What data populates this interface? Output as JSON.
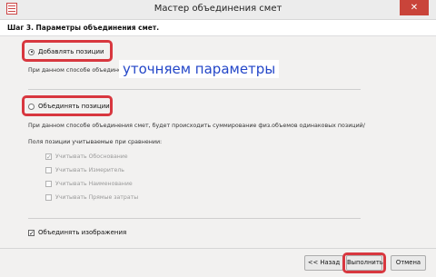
{
  "window": {
    "title": "Мастер объединения смет",
    "close_label": "✕"
  },
  "step": {
    "title": "Шаг 3. Параметры объединения смет."
  },
  "options": {
    "add_positions": {
      "label": "Добавлять позиции",
      "checked": true,
      "description": "При данном способе объединения                                                                                 й документ друг за другом."
    },
    "merge_positions": {
      "label": "Объединять позиции",
      "checked": false,
      "description": "При данном способе объединения смет, будет происходить суммирование физ.объемов одинаковых позиций/"
    }
  },
  "compare_fields": {
    "label": "Поля позиции учитываемые при сравнении:",
    "items": [
      {
        "label": "Учитывать Обоснование",
        "checked": true
      },
      {
        "label": "Учитывать Измеритель",
        "checked": false
      },
      {
        "label": "Учитывать Наименование",
        "checked": false
      },
      {
        "label": "Учитывать Прямые затраты",
        "checked": false
      }
    ]
  },
  "merge_images": {
    "label": "Объединять изображения",
    "checked": true
  },
  "overlay_text": "уточняем параметры",
  "buttons": {
    "back": "<< Назад",
    "run": "Выполнить",
    "cancel": "Отмена"
  },
  "colors": {
    "highlight_frame": "#d8373f",
    "overlay_text": "#2346c8",
    "close_button": "#c9443a"
  },
  "icons": {
    "app": "app-icon",
    "close": "close-icon"
  }
}
